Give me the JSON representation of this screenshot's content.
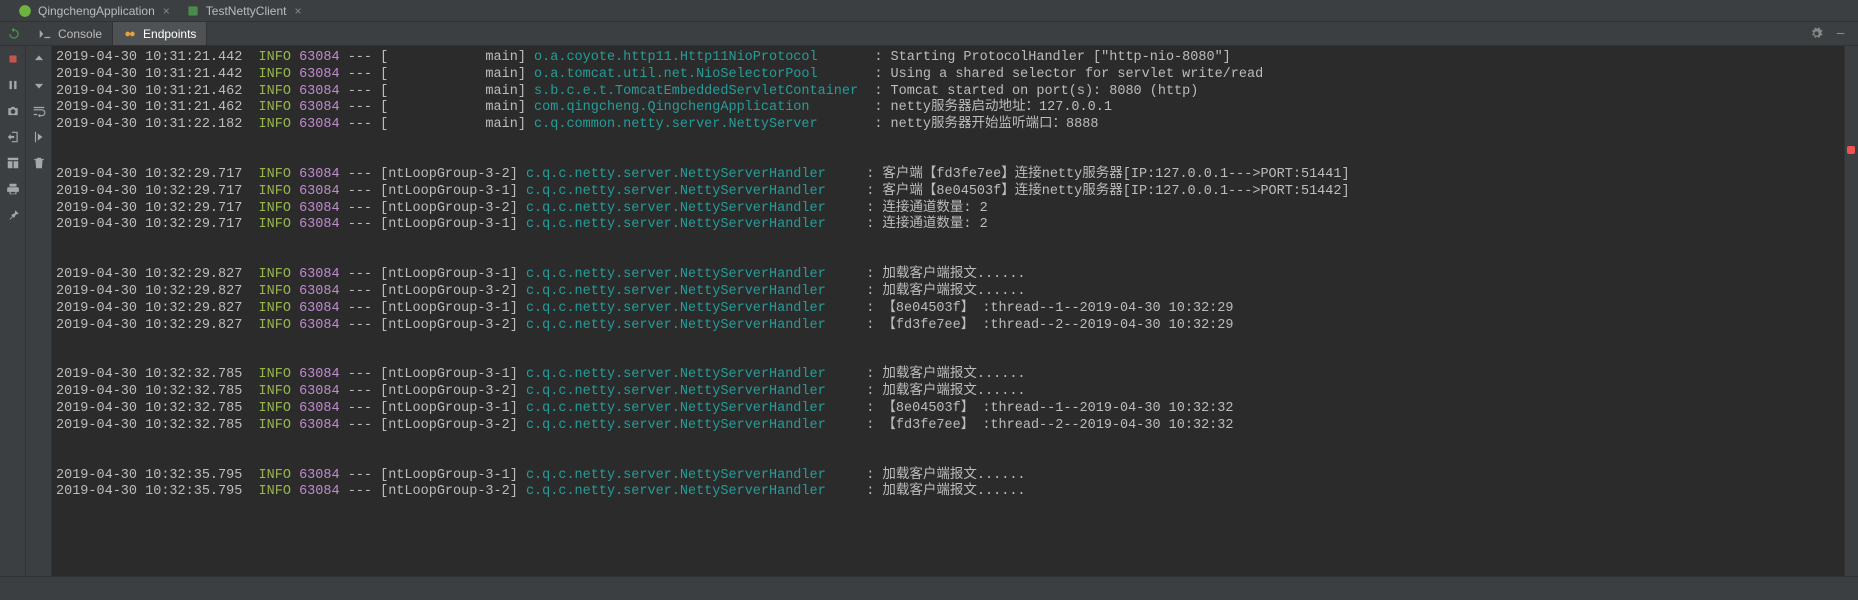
{
  "topTabs": [
    {
      "label": "QingchengApplication",
      "icon": "spring"
    },
    {
      "label": "TestNettyClient",
      "icon": "app"
    }
  ],
  "viewTabs": {
    "console": "Console",
    "endpoints": "Endpoints"
  },
  "runControls": {
    "rerun": "Rerun",
    "stop": "Stop",
    "pause": "Pause",
    "camera": "Dump Threads",
    "exit": "Exit",
    "layout": "Layout",
    "print": "Print",
    "pin": "Pin"
  },
  "logs": [
    {
      "ts": "2019-04-30 10:31:21.442",
      "level": "INFO",
      "pid": "63084",
      "thread": "[            main]",
      "logger": "o.a.coyote.http11.Http11NioProtocol       ",
      "msg": "Starting ProtocolHandler [\"http-nio-8080\"]"
    },
    {
      "ts": "2019-04-30 10:31:21.442",
      "level": "INFO",
      "pid": "63084",
      "thread": "[            main]",
      "logger": "o.a.tomcat.util.net.NioSelectorPool       ",
      "msg": "Using a shared selector for servlet write/read"
    },
    {
      "ts": "2019-04-30 10:31:21.462",
      "level": "INFO",
      "pid": "63084",
      "thread": "[            main]",
      "logger": "s.b.c.e.t.TomcatEmbeddedServletContainer  ",
      "msg": "Tomcat started on port(s): 8080 (http)"
    },
    {
      "ts": "2019-04-30 10:31:21.462",
      "level": "INFO",
      "pid": "63084",
      "thread": "[            main]",
      "logger": "com.qingcheng.QingchengApplication        ",
      "msg": "netty服务器启动地址：127.0.0.1"
    },
    {
      "ts": "2019-04-30 10:31:22.182",
      "level": "INFO",
      "pid": "63084",
      "thread": "[            main]",
      "logger": "c.q.common.netty.server.NettyServer       ",
      "msg": "netty服务器开始监听端口：8888"
    },
    {
      "blank": true
    },
    {
      "ts": "2019-04-30 10:32:29.717",
      "level": "INFO",
      "pid": "63084",
      "thread": "[ntLoopGroup-3-2]",
      "logger": "c.q.c.netty.server.NettyServerHandler     ",
      "msg": "客户端【fd3fe7ee】连接netty服务器[IP:127.0.0.1--->PORT:51441]"
    },
    {
      "ts": "2019-04-30 10:32:29.717",
      "level": "INFO",
      "pid": "63084",
      "thread": "[ntLoopGroup-3-1]",
      "logger": "c.q.c.netty.server.NettyServerHandler     ",
      "msg": "客户端【8e04503f】连接netty服务器[IP:127.0.0.1--->PORT:51442]"
    },
    {
      "ts": "2019-04-30 10:32:29.717",
      "level": "INFO",
      "pid": "63084",
      "thread": "[ntLoopGroup-3-2]",
      "logger": "c.q.c.netty.server.NettyServerHandler     ",
      "msg": "连接通道数量: 2"
    },
    {
      "ts": "2019-04-30 10:32:29.717",
      "level": "INFO",
      "pid": "63084",
      "thread": "[ntLoopGroup-3-1]",
      "logger": "c.q.c.netty.server.NettyServerHandler     ",
      "msg": "连接通道数量: 2"
    },
    {
      "blank": true
    },
    {
      "ts": "2019-04-30 10:32:29.827",
      "level": "INFO",
      "pid": "63084",
      "thread": "[ntLoopGroup-3-1]",
      "logger": "c.q.c.netty.server.NettyServerHandler     ",
      "msg": "加载客户端报文......"
    },
    {
      "ts": "2019-04-30 10:32:29.827",
      "level": "INFO",
      "pid": "63084",
      "thread": "[ntLoopGroup-3-2]",
      "logger": "c.q.c.netty.server.NettyServerHandler     ",
      "msg": "加载客户端报文......"
    },
    {
      "ts": "2019-04-30 10:32:29.827",
      "level": "INFO",
      "pid": "63084",
      "thread": "[ntLoopGroup-3-1]",
      "logger": "c.q.c.netty.server.NettyServerHandler     ",
      "msg": "【8e04503f】 :thread--1--2019-04-30 10:32:29"
    },
    {
      "ts": "2019-04-30 10:32:29.827",
      "level": "INFO",
      "pid": "63084",
      "thread": "[ntLoopGroup-3-2]",
      "logger": "c.q.c.netty.server.NettyServerHandler     ",
      "msg": "【fd3fe7ee】 :thread--2--2019-04-30 10:32:29"
    },
    {
      "blank": true
    },
    {
      "ts": "2019-04-30 10:32:32.785",
      "level": "INFO",
      "pid": "63084",
      "thread": "[ntLoopGroup-3-1]",
      "logger": "c.q.c.netty.server.NettyServerHandler     ",
      "msg": "加载客户端报文......"
    },
    {
      "ts": "2019-04-30 10:32:32.785",
      "level": "INFO",
      "pid": "63084",
      "thread": "[ntLoopGroup-3-2]",
      "logger": "c.q.c.netty.server.NettyServerHandler     ",
      "msg": "加载客户端报文......"
    },
    {
      "ts": "2019-04-30 10:32:32.785",
      "level": "INFO",
      "pid": "63084",
      "thread": "[ntLoopGroup-3-1]",
      "logger": "c.q.c.netty.server.NettyServerHandler     ",
      "msg": "【8e04503f】 :thread--1--2019-04-30 10:32:32"
    },
    {
      "ts": "2019-04-30 10:32:32.785",
      "level": "INFO",
      "pid": "63084",
      "thread": "[ntLoopGroup-3-2]",
      "logger": "c.q.c.netty.server.NettyServerHandler     ",
      "msg": "【fd3fe7ee】 :thread--2--2019-04-30 10:32:32"
    },
    {
      "blank": true
    },
    {
      "ts": "2019-04-30 10:32:35.795",
      "level": "INFO",
      "pid": "63084",
      "thread": "[ntLoopGroup-3-1]",
      "logger": "c.q.c.netty.server.NettyServerHandler     ",
      "msg": "加载客户端报文......"
    },
    {
      "ts": "2019-04-30 10:32:35.795",
      "level": "INFO",
      "pid": "63084",
      "thread": "[ntLoopGroup-3-2]",
      "logger": "c.q.c.netty.server.NettyServerHandler     ",
      "msg": "加载客户端报文......"
    }
  ]
}
